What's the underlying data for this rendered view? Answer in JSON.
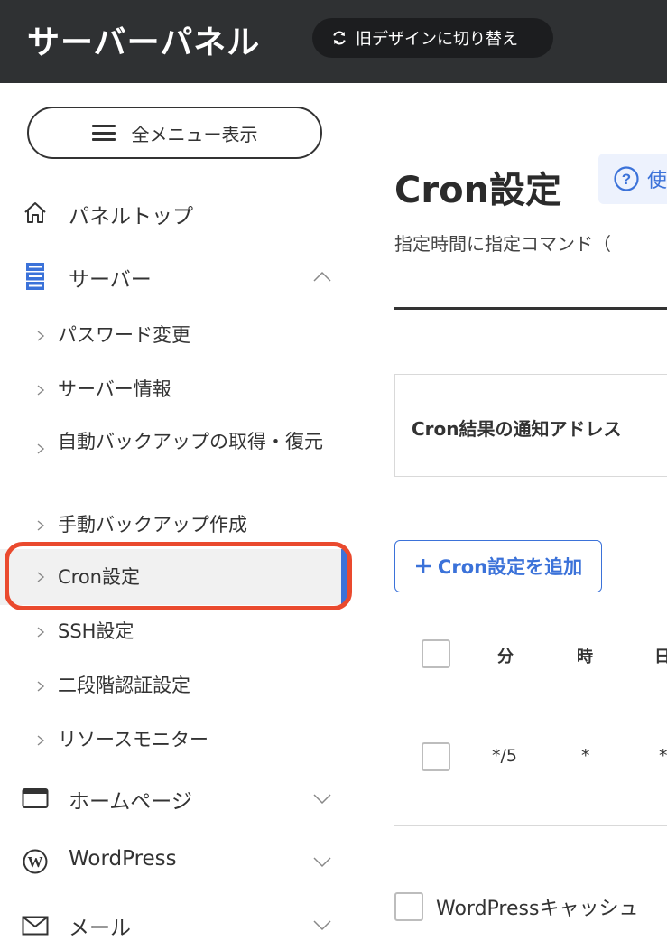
{
  "header": {
    "brand": "サーバーパネル",
    "old_design_label": "旧デザインに切り替え"
  },
  "sidebar": {
    "all_menu_label": "全メニュー表示",
    "items": [
      {
        "label": "パネルトップ",
        "icon": "home-icon"
      },
      {
        "label": "サーバー",
        "icon": "server-icon",
        "expanded": true
      },
      {
        "label": "ホームページ",
        "icon": "browser-window-icon",
        "expanded": false
      },
      {
        "label": "WordPress",
        "icon": "wordpress-icon",
        "expanded": false
      },
      {
        "label": "メール",
        "icon": "mail-icon",
        "expanded": false
      }
    ],
    "server_subitems": [
      "パスワード変更",
      "サーバー情報",
      "自動バックアップの取得・復元",
      "手動バックアップ作成",
      "Cron設定",
      "SSH設定",
      "二段階認証設定",
      "リソースモニター"
    ],
    "active_item": "Cron設定",
    "accent_color": "#3b72d9",
    "highlight_color": "#ea4a2e"
  },
  "main": {
    "title": "Cron設定",
    "usage_label": "使",
    "description": "指定時間に指定コマンド（",
    "notify_label": "Cron結果の通知アドレス",
    "add_button_label": "Cron設定を追加",
    "table": {
      "headers": [
        "分",
        "時",
        "日"
      ],
      "rows": [
        [
          "*/5",
          "*",
          "*"
        ]
      ]
    },
    "wp_cache_label": "WordPressキャッシュ"
  }
}
